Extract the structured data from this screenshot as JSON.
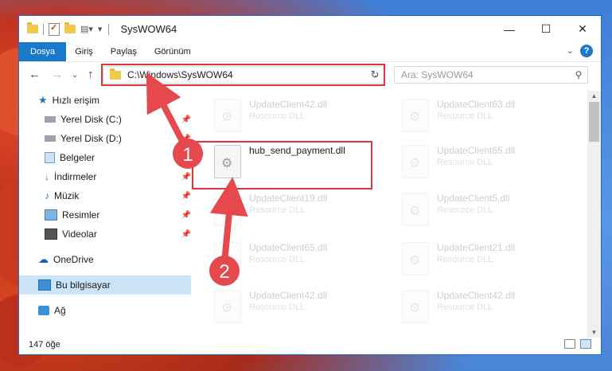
{
  "window": {
    "title": "SysWOW64"
  },
  "ribbon": {
    "tabs": [
      "Dosya",
      "Giriş",
      "Paylaş",
      "Görünüm"
    ]
  },
  "navigation": {
    "address": "C:\\Windows\\SysWOW64",
    "search_placeholder": "Ara: SysWOW64"
  },
  "sidebar": {
    "quick_access": "Hızlı erişim",
    "items": [
      "Yerel Disk (C:)",
      "Yerel Disk (D:)",
      "Belgeler",
      "İndirmeler",
      "Müzik",
      "Resimler",
      "Videolar"
    ],
    "onedrive": "OneDrive",
    "this_pc": "Bu bilgisayar",
    "network": "Ağ"
  },
  "files": {
    "highlighted": {
      "name": "hub_send_payment.dll"
    },
    "background": [
      {
        "name": "UpdateClient42.dll",
        "type": "Resource DLL"
      },
      {
        "name": "UpdateClient63.dll",
        "type": "Resource DLL"
      },
      {
        "name": "UpdateClient65.dll",
        "type": "Resource DLL"
      },
      {
        "name": "UpdateClient19.dll",
        "type": "Resource DLL"
      },
      {
        "name": "UpdateClient5.dll",
        "type": "Resource DLL"
      },
      {
        "name": "UpdateClient65.dll",
        "type": "Resource DLL"
      },
      {
        "name": "UpdateClient21.dll",
        "type": "Resource DLL"
      },
      {
        "name": "UpdateClient42.dll",
        "type": "Resource DLL"
      },
      {
        "name": "UpdateClient42.dll",
        "type": "Resource DLL"
      }
    ]
  },
  "annotations": {
    "step1": "1",
    "step2": "2"
  },
  "status": {
    "count": "147 öğe"
  },
  "colors": {
    "accent": "#1979ca",
    "highlight_box": "#d9373c",
    "arrow": "#e5484d"
  }
}
